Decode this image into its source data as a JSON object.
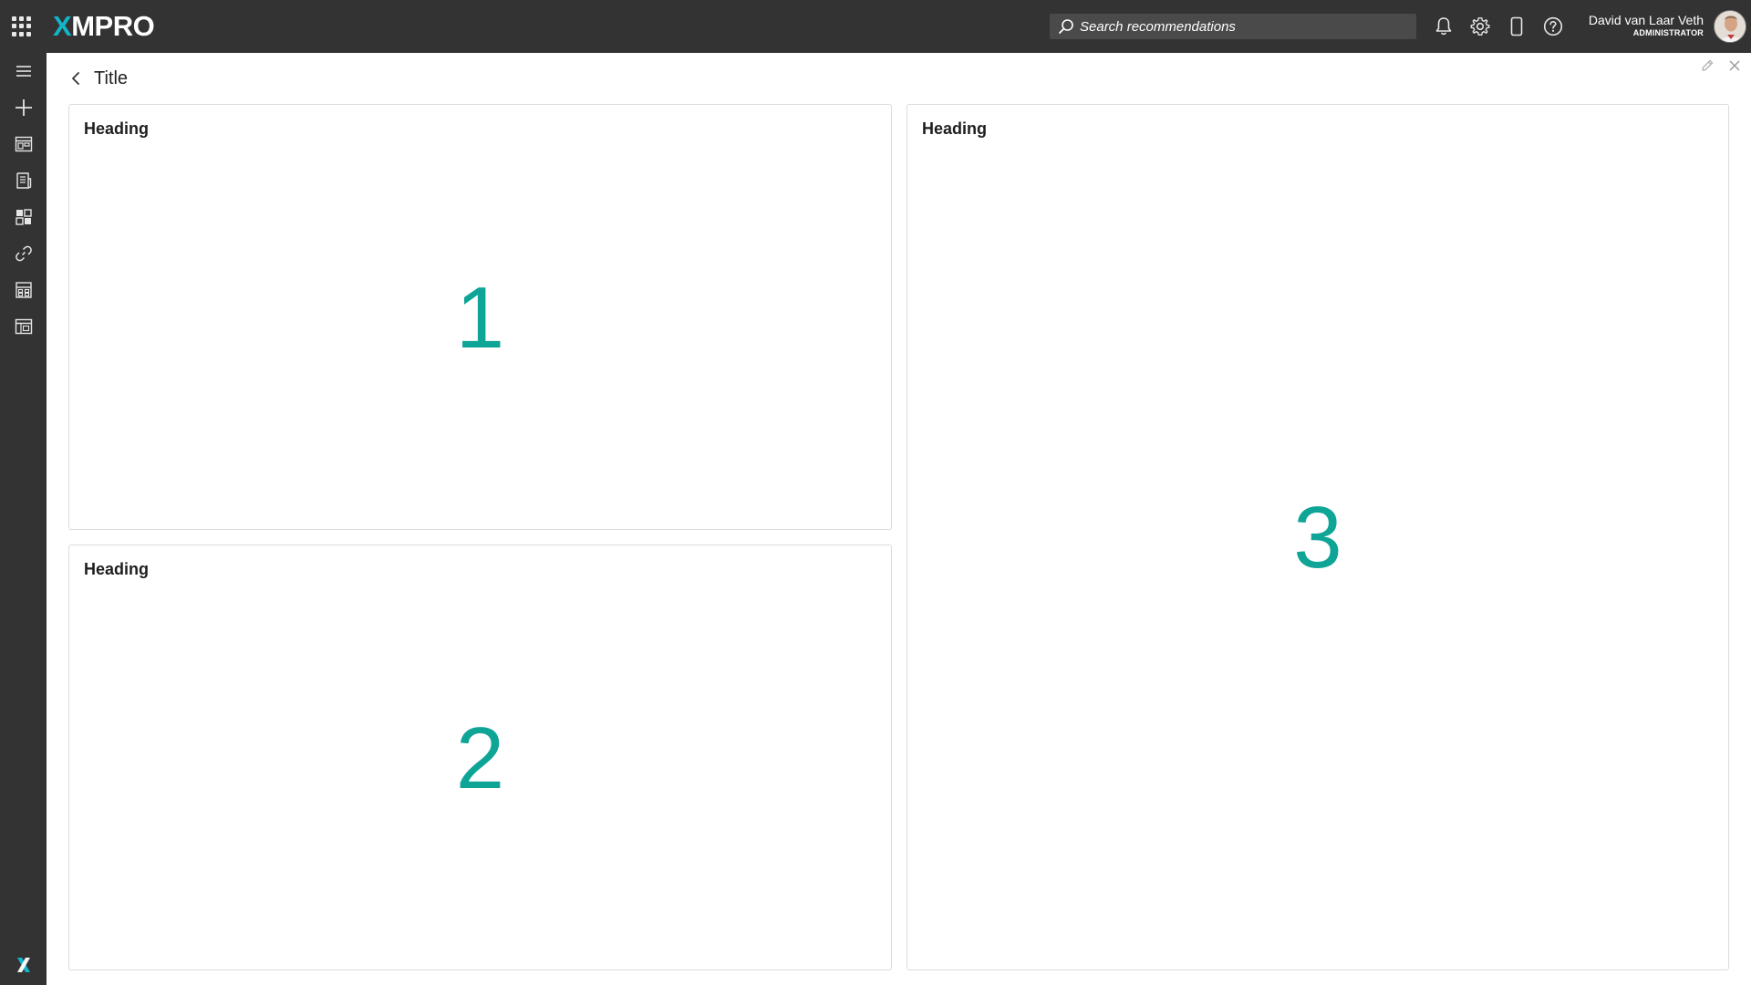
{
  "header": {
    "logo": {
      "prefix": "X",
      "rest": "MPRO"
    },
    "search": {
      "placeholder": "Search recommendations"
    },
    "icons": [
      "apps-grid-icon",
      "search-icon",
      "bell-icon",
      "gear-icon",
      "mobile-icon",
      "help-icon"
    ],
    "user": {
      "name": "David van Laar Veth",
      "role": "ADMINISTRATOR"
    }
  },
  "sidebar": {
    "items": [
      "menu-icon",
      "add-icon",
      "app-designer-icon",
      "reports-icon",
      "blocks-icon",
      "link-icon",
      "calculator-icon",
      "table-icon"
    ],
    "footer_logo": "X"
  },
  "page": {
    "title": "Title",
    "cards": [
      {
        "heading": "Heading",
        "number": "1"
      },
      {
        "heading": "Heading",
        "number": "2"
      },
      {
        "heading": "Heading",
        "number": "3"
      }
    ]
  },
  "colors": {
    "topbar": "#333333",
    "sidebar": "#333333",
    "accent_number": "#0ea597",
    "logo_x": "#12b5c9",
    "card_border": "#dcdcdc"
  }
}
